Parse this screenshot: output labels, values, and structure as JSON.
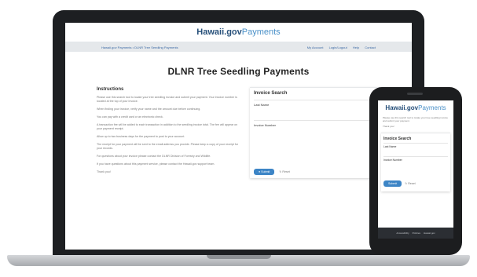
{
  "laptop": {
    "header": {
      "logo_bold": "Hawaii.gov",
      "logo_light": "Payments"
    },
    "nav": {
      "breadcrumb": "Hawaii.gov Payments • DLNR Tree Seedling Payments",
      "links": [
        "My Account",
        "Login/Logout",
        "Help",
        "Contact"
      ]
    },
    "page_title": "DLNR Tree Seedling Payments",
    "instructions": {
      "title": "Instructions",
      "paragraphs": [
        "Please use this search tool to locate your tree seedling invoice and submit your payment. Your invoice number is located at the top of your invoice.",
        "When finding your invoice, verify your name and the amount due before continuing.",
        "You can pay with a credit card or an electronic check.",
        "A transaction fee will be added to each transaction in addition to the seedling invoice total. The fee will appear on your payment receipt.",
        "Allow up to two business days for the payment to post to your account.",
        "The receipt for your payment will be sent to the email address you provide. Please keep a copy of your receipt for your records.",
        "For questions about your invoice please contact the DLNR Division of Forestry and Wildlife.",
        "If you have questions about this payment service, please contact the Hawaii.gov support team.",
        "Thank you!"
      ]
    },
    "search": {
      "title": "Invoice Search",
      "fields": [
        "Last Name",
        "Invoice Number"
      ],
      "submit_label": "Submit",
      "reset_label": "Reset"
    }
  },
  "phone": {
    "header": {
      "logo_bold": "Hawaii.gov",
      "logo_light": "Payments"
    },
    "paragraphs": [
      "Please use this search tool to locate your tree seedling invoice and submit your payment.",
      "Thank you!"
    ],
    "search": {
      "title": "Invoice Search",
      "fields": [
        "Last Name",
        "Invoice Number"
      ],
      "submit_label": "Submit",
      "reset_label": "Reset"
    },
    "footer_links": [
      "Accessibility",
      "Policies",
      "Hawaii.gov"
    ]
  }
}
